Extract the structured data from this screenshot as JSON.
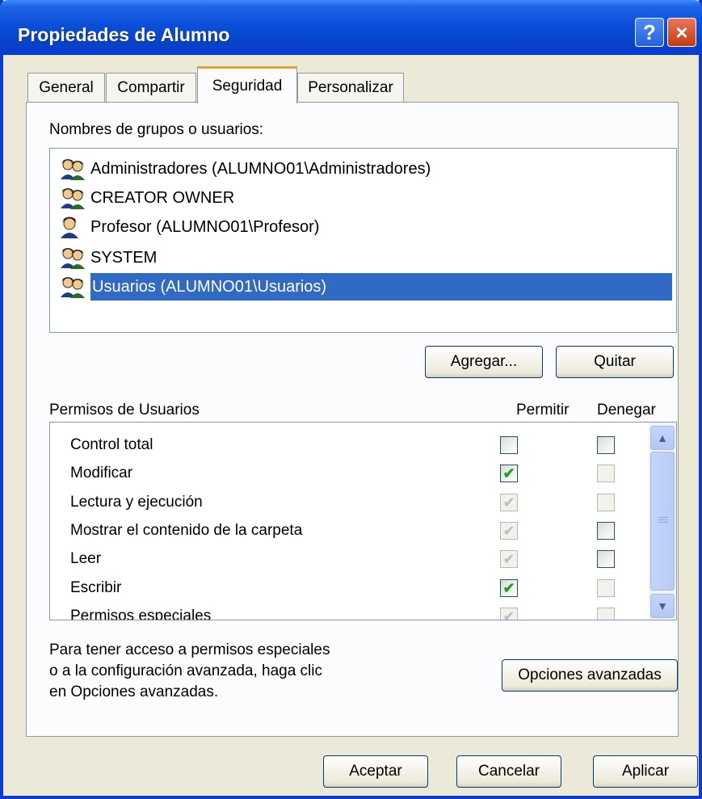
{
  "window": {
    "title": "Propiedades de Alumno",
    "help_glyph": "?",
    "close_glyph": "×"
  },
  "tabs": [
    {
      "label": "General",
      "active": false
    },
    {
      "label": "Compartir",
      "active": false
    },
    {
      "label": "Seguridad",
      "active": true
    },
    {
      "label": "Personalizar",
      "active": false
    }
  ],
  "groups": {
    "label": "Nombres de grupos o usuarios:",
    "items": [
      {
        "name": "Administradores (ALUMNO01\\Administradores)",
        "icon": "group-icon",
        "selected": false
      },
      {
        "name": "CREATOR OWNER",
        "icon": "group-icon",
        "selected": false
      },
      {
        "name": "Profesor (ALUMNO01\\Profesor)",
        "icon": "user-icon",
        "selected": false
      },
      {
        "name": "SYSTEM",
        "icon": "group-icon",
        "selected": false
      },
      {
        "name": "Usuarios (ALUMNO01\\Usuarios)",
        "icon": "group-icon",
        "selected": true
      }
    ],
    "add_label": "Agregar...",
    "remove_label": "Quitar"
  },
  "permissions": {
    "title": "Permisos de Usuarios",
    "allow_header": "Permitir",
    "deny_header": "Denegar",
    "rows": [
      {
        "name": "Control total",
        "allow": "unchecked",
        "deny": "unchecked"
      },
      {
        "name": "Modificar",
        "allow": "checked",
        "deny": "unchecked-disabled"
      },
      {
        "name": "Lectura y ejecución",
        "allow": "checked-disabled",
        "deny": "unchecked-disabled"
      },
      {
        "name": "Mostrar el contenido de la carpeta",
        "allow": "checked-disabled",
        "deny": "unchecked"
      },
      {
        "name": "Leer",
        "allow": "checked-disabled",
        "deny": "unchecked"
      },
      {
        "name": "Escribir",
        "allow": "checked",
        "deny": "unchecked-disabled"
      },
      {
        "name": "Permisos especiales",
        "allow": "checked-disabled",
        "deny": "unchecked-disabled"
      }
    ]
  },
  "advanced": {
    "text_line1": "Para tener acceso a permisos especiales",
    "text_line2": "o a la configuración avanzada, haga clic",
    "text_line3": "en Opciones avanzadas.",
    "button_label": "Opciones avanzadas"
  },
  "footer": {
    "ok_label": "Aceptar",
    "cancel_label": "Cancelar",
    "apply_label": "Aplicar"
  },
  "colors": {
    "accent": "#0a3bd4",
    "selection": "#316ac5",
    "check": "#21a121"
  }
}
